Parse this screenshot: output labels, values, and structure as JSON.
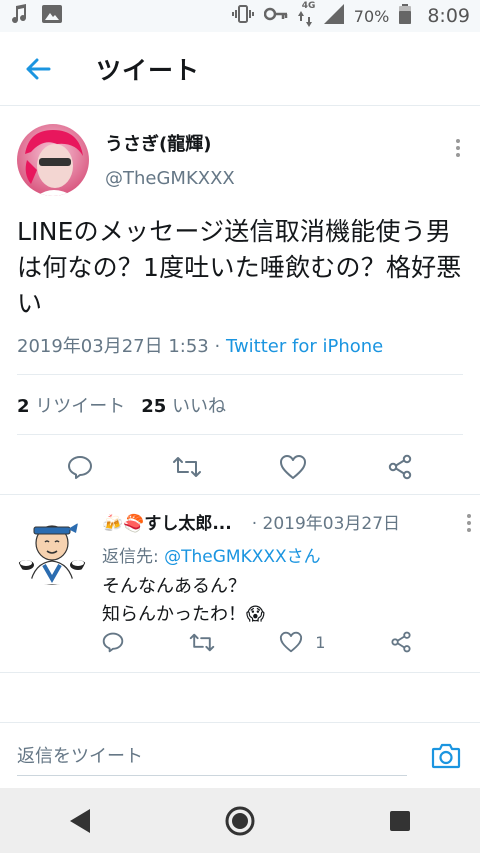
{
  "status_bar": {
    "signal_type": "4G",
    "battery": "70%",
    "time": "8:09",
    "icons": [
      "music-note-icon",
      "image-icon",
      "vibrate-icon",
      "key-icon",
      "data-arrows-icon",
      "signal-icon",
      "battery-icon"
    ]
  },
  "header": {
    "title": "ツイート",
    "back_icon": "arrow-left-icon"
  },
  "tweet": {
    "display_name": "うさぎ(龍輝)",
    "handle": "@TheGMKXXX",
    "text": "LINEのメッセージ送信取消機能使う男は何なの？1度吐いた唾飲むの？格好悪い",
    "datetime": "2019年03月27日 1:53 · ",
    "source": "Twitter for iPhone",
    "retweet_count": "2",
    "retweet_label": " リツイート",
    "like_count": "25",
    "like_label": " いいね"
  },
  "reply": {
    "display_name": "🍻🍣すし太郎...",
    "date": "· 2019年03月27日",
    "replying_prefix": "返信先: ",
    "replying_to": "@TheGMKXXXさん",
    "text_line1": "そんなんあるん？",
    "text_line2": "知らんかったわ！😱",
    "like_count": "1"
  },
  "compose": {
    "placeholder": "返信をツイート"
  },
  "colors": {
    "accent": "#1b95e0",
    "secondary_text": "#657786",
    "divider": "#e6ecf0"
  }
}
